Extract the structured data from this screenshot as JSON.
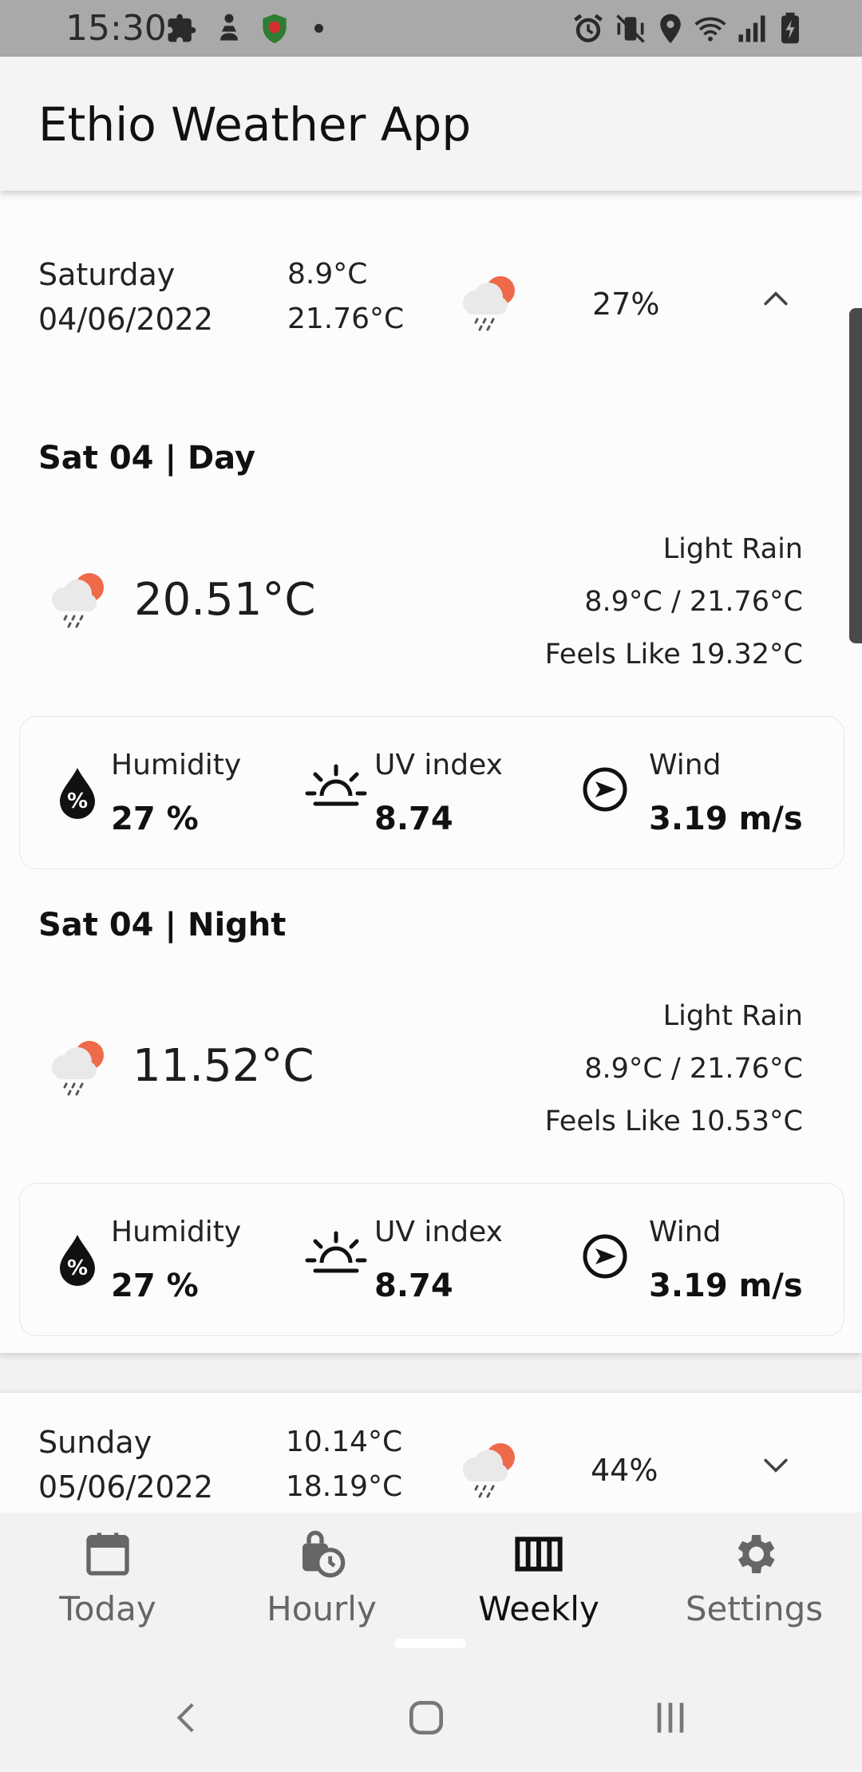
{
  "status_bar": {
    "time": "15:30"
  },
  "app_bar": {
    "title": "Ethio Weather App"
  },
  "days": [
    {
      "day": "Saturday",
      "date": "04/06/2022",
      "temp_min": "8.9°C",
      "temp_max": "21.76°C",
      "chance": "27%",
      "expanded": true,
      "periods": [
        {
          "title": "Sat 04 | Day",
          "temp": "20.51°C",
          "condition": "Light Rain",
          "range": "8.9°C / 21.76°C",
          "feels_like": "Feels Like 19.32°C",
          "humidity_label": "Humidity",
          "humidity_value": "27 %",
          "uv_label": "UV index",
          "uv_value": "8.74",
          "wind_label": "Wind",
          "wind_value": "3.19 m/s"
        },
        {
          "title": "Sat 04 | Night",
          "temp": "11.52°C",
          "condition": "Light Rain",
          "range": "8.9°C / 21.76°C",
          "feels_like": "Feels Like 10.53°C",
          "humidity_label": "Humidity",
          "humidity_value": "27 %",
          "uv_label": "UV index",
          "uv_value": "8.74",
          "wind_label": "Wind",
          "wind_value": "3.19 m/s"
        }
      ]
    },
    {
      "day": "Sunday",
      "date": "05/06/2022",
      "temp_min": "10.14°C",
      "temp_max": "18.19°C",
      "chance": "44%",
      "expanded": false
    }
  ],
  "bottom_nav": {
    "items": [
      {
        "label": "Today",
        "icon": "calendar-icon"
      },
      {
        "label": "Hourly",
        "icon": "clock-bag-icon"
      },
      {
        "label": "Weekly",
        "icon": "week-columns-icon"
      },
      {
        "label": "Settings",
        "icon": "gear-icon"
      }
    ],
    "active": "Weekly"
  },
  "colors": {
    "sun": "#ee6a4a",
    "cloud": "#e6e6e6",
    "rain": "#555555"
  }
}
